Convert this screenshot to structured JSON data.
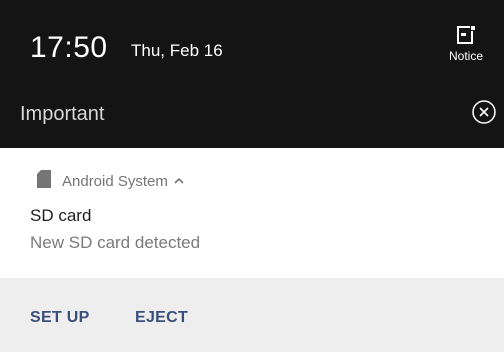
{
  "status_bar": {
    "time": "17:50",
    "date": "Thu, Feb 16",
    "notice_label": "Notice"
  },
  "section": {
    "label": "Important"
  },
  "notification": {
    "app_name": "Android System",
    "title": "SD card",
    "text": "New SD card detected",
    "actions": [
      {
        "label": "SET UP"
      },
      {
        "label": "EJECT"
      }
    ]
  },
  "icons": {
    "notice": "notice-icon",
    "dismiss": "close-circle-icon",
    "app": "sd-card-icon",
    "expand": "chevron-up-icon"
  },
  "colors": {
    "header_bg": "#141414",
    "actions_bg": "#eeeeee",
    "action_text": "#3a4f7a"
  }
}
